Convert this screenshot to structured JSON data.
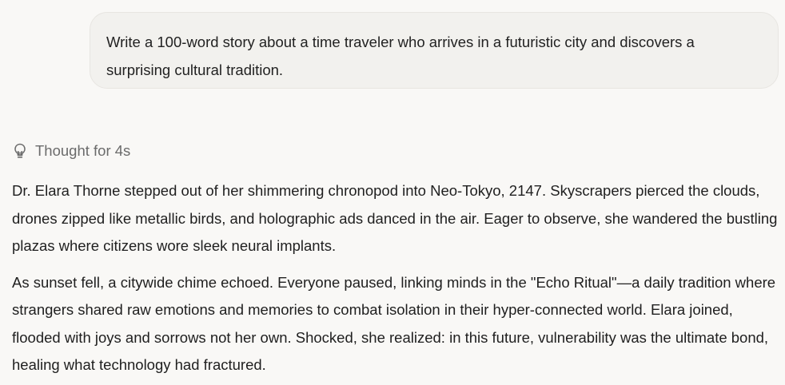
{
  "user_message": {
    "text": "Write a 100-word story about a time traveler who arrives in a futuristic city and discovers a surprising cultural tradition."
  },
  "thought": {
    "icon": "lightbulb-icon",
    "label": "Thought for 4s"
  },
  "response": {
    "paragraphs": [
      "Dr. Elara Thorne stepped out of her shimmering chronopod into Neo-Tokyo, 2147. Skyscrapers pierced the clouds, drones zipped like metallic birds, and holographic ads danced in the air. Eager to observe, she wandered the bustling plazas where citizens wore sleek neural implants.",
      "As sunset fell, a citywide chime echoed. Everyone paused, linking minds in the \"Echo Ritual\"—a daily tradition where strangers shared raw emotions and memories to combat isolation in their hyper-connected world. Elara joined, flooded with joys and sorrows not her own. Shocked, she realized: in this future, vulnerability was the ultimate bond, healing what technology had fractured."
    ]
  }
}
